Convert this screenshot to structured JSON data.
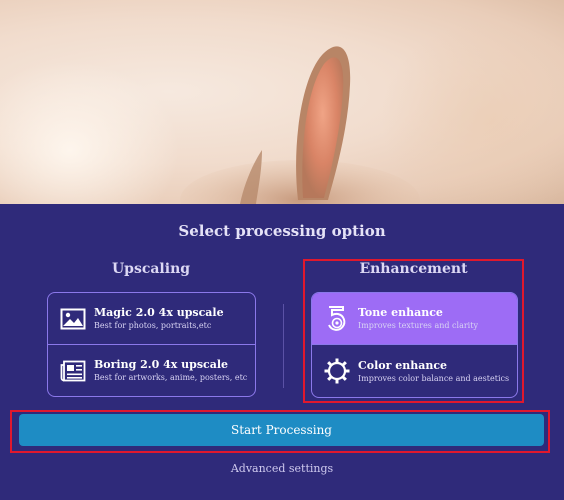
{
  "panel": {
    "title": "Select processing option",
    "upscaling": {
      "heading": "Upscaling",
      "options": [
        {
          "name": "Magic 2.0 4x upscale",
          "desc": "Best for photos, portraits,etc",
          "icon": "image-icon"
        },
        {
          "name": "Boring 2.0 4x upscale",
          "desc": "Best for artworks, anime, posters, etc",
          "icon": "newspaper-icon"
        }
      ]
    },
    "enhancement": {
      "heading": "Enhancement",
      "options": [
        {
          "name": "Tone enhance",
          "desc": "Improves textures and clarity",
          "icon": "tone-enhance-icon",
          "selected": true
        },
        {
          "name": "Color enhance",
          "desc": "Improves color balance and aestetics",
          "icon": "color-enhance-gear-icon",
          "selected": false
        }
      ]
    },
    "start_button": "Start Processing",
    "advanced_link": "Advanced settings"
  },
  "colors": {
    "panel_bg": "#2f2a7a",
    "accent_purple": "#9d6cf5",
    "button_blue": "#1e8cc4",
    "highlight_red": "#e0182d"
  }
}
